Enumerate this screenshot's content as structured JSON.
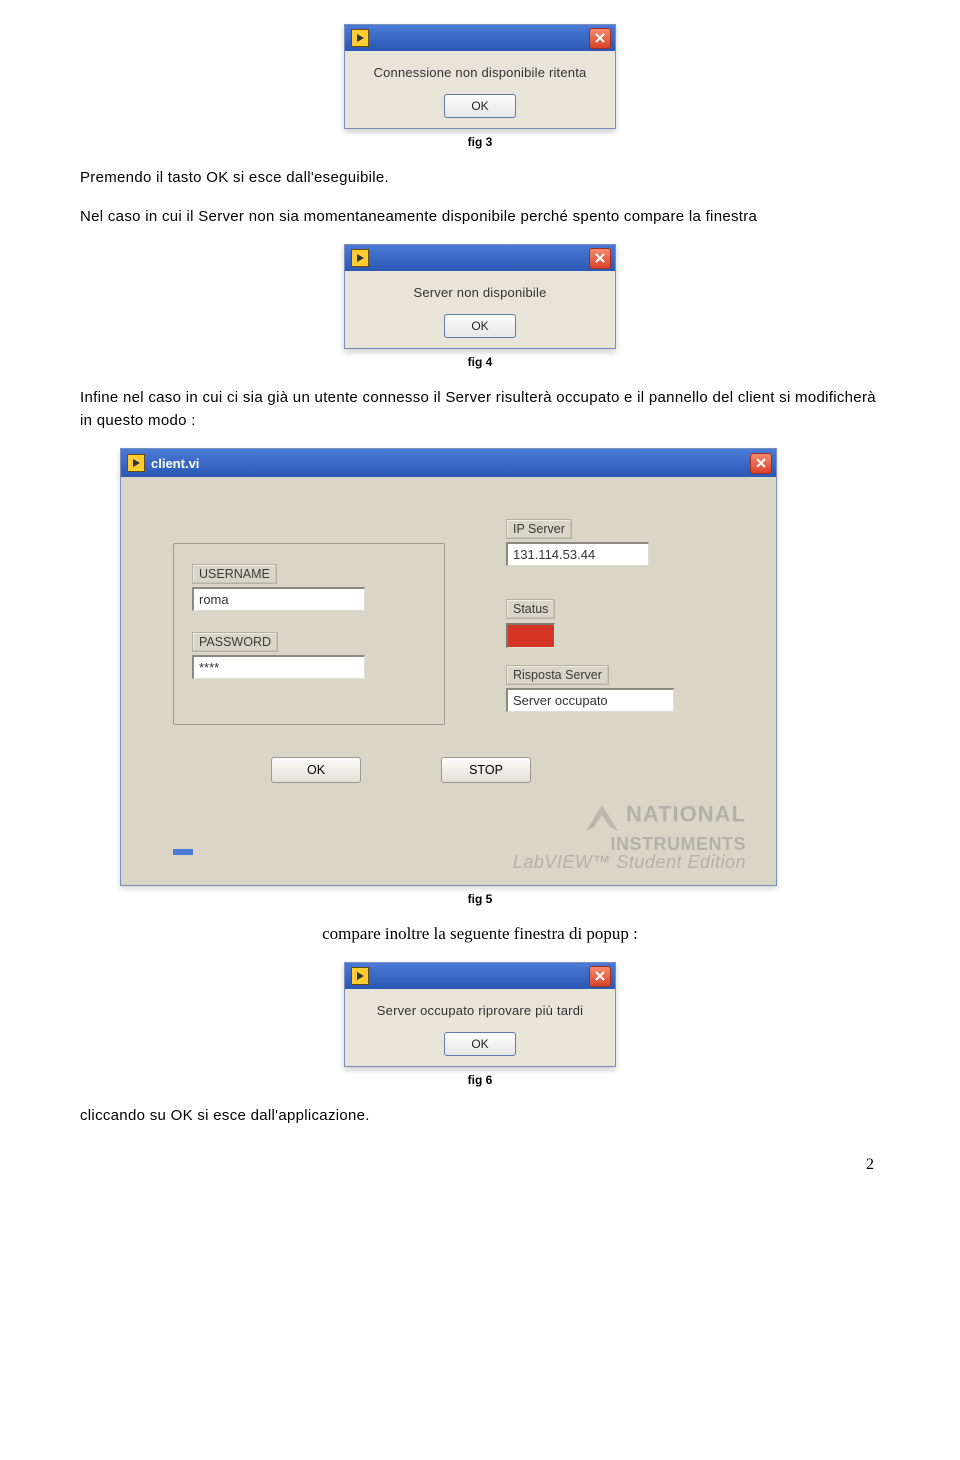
{
  "fig3": {
    "caption": "fig 3",
    "message": "Connessione non disponibile ritenta",
    "ok_label": "OK"
  },
  "para1": "Premendo il tasto OK si esce dall'eseguibile.",
  "para2": "Nel caso in cui il Server non sia momentaneamente disponibile perché spento compare la finestra",
  "fig4": {
    "caption": "fig 4",
    "message": "Server non disponibile",
    "ok_label": "OK"
  },
  "para3": "Infine nel caso in cui ci sia già un utente connesso il Server risulterà occupato e il pannello del client si modificherà in questo modo :",
  "fig5": {
    "caption": "fig 5",
    "title": "client.vi",
    "username_label": "USERNAME",
    "username_value": "roma",
    "password_label": "PASSWORD",
    "password_value": "****",
    "ipserver_label": "IP Server",
    "ipserver_value": "131.114.53.44",
    "status_label": "Status",
    "risposta_label": "Risposta Server",
    "risposta_value": "Server occupato",
    "ok_label": "OK",
    "stop_label": "STOP",
    "watermark_line1": "NATIONAL",
    "watermark_line2": "INSTRUMENTS",
    "watermark_line3": "LabVIEW™ Student Edition"
  },
  "para4": "compare inoltre la seguente finestra di popup :",
  "fig6": {
    "caption": "fig 6",
    "message": "Server occupato riprovare più tardi",
    "ok_label": "OK"
  },
  "para5": "cliccando su OK si esce dall'applicazione.",
  "page_number": "2"
}
